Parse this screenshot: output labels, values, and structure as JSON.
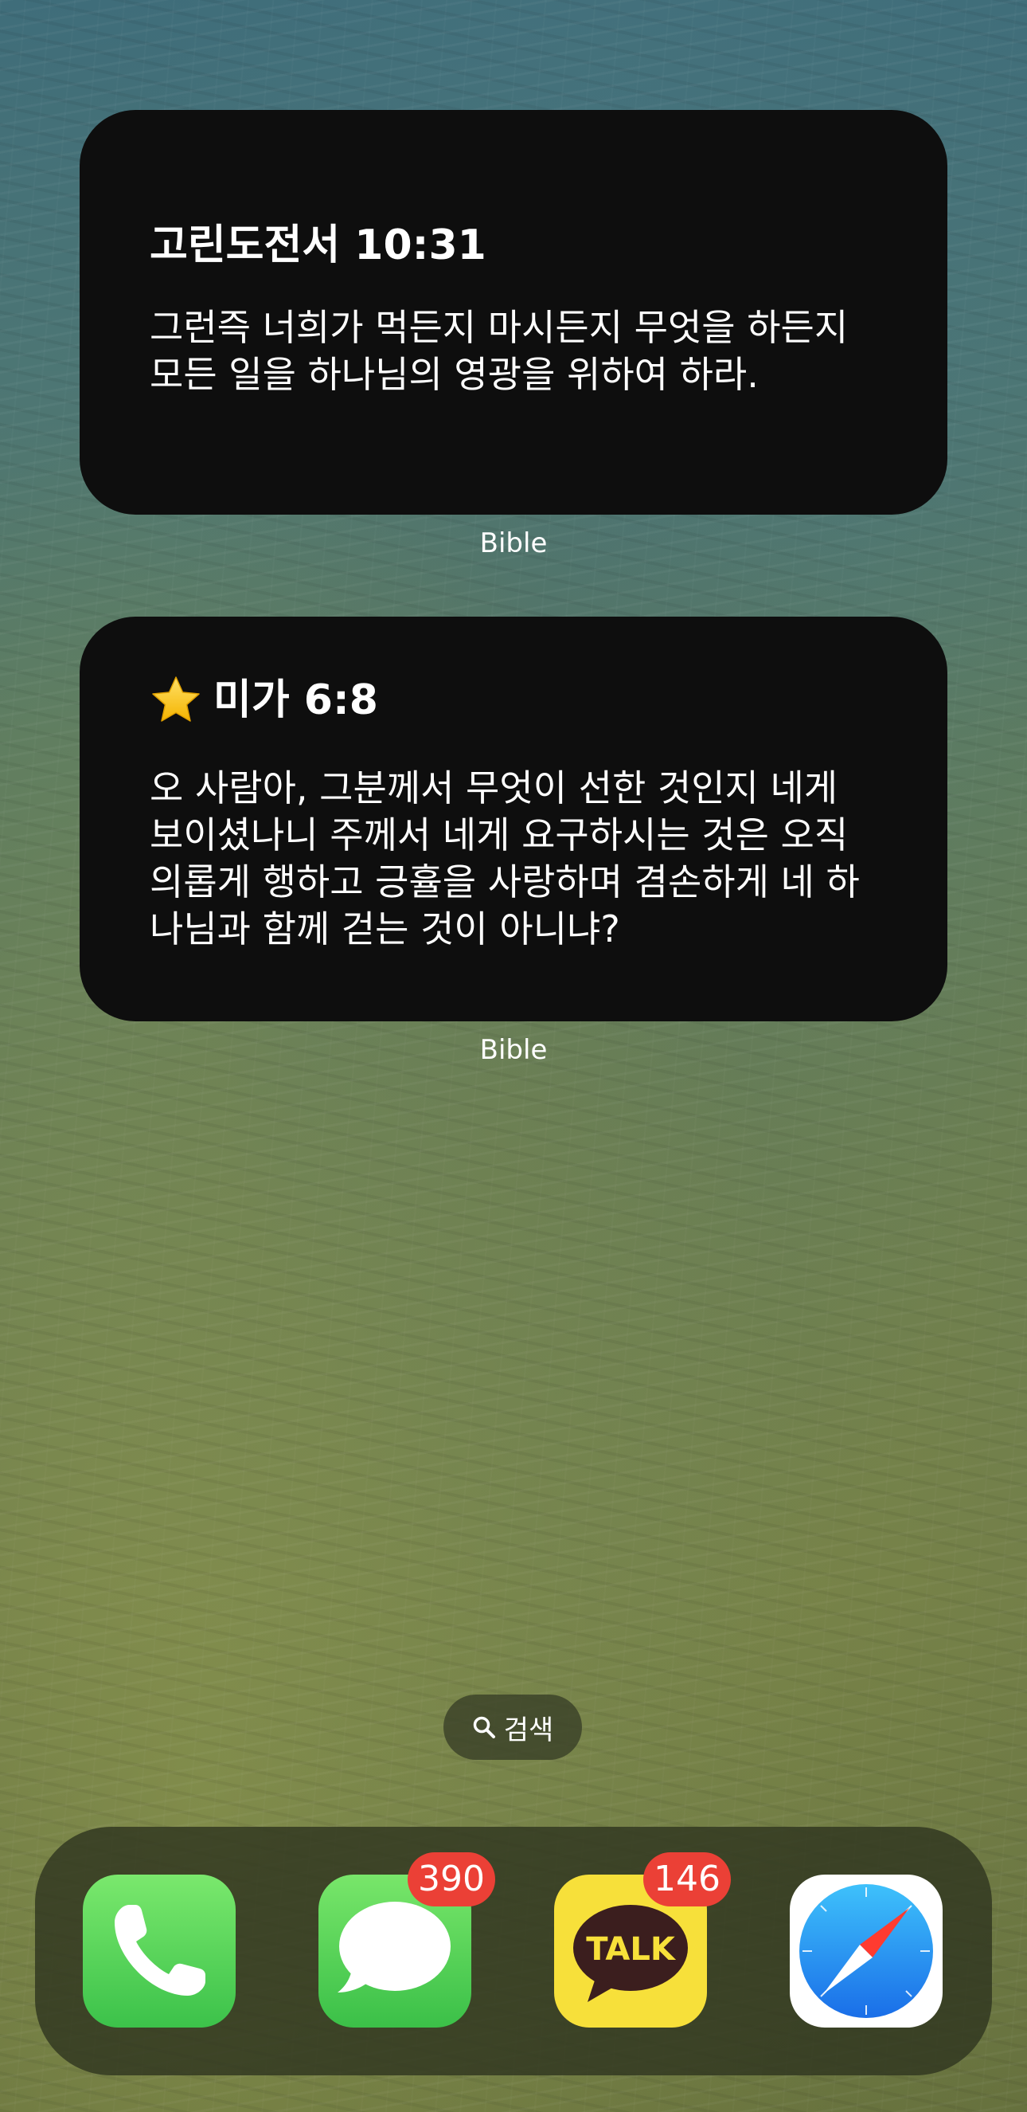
{
  "widgets": [
    {
      "title": "고린도전서 10:31",
      "body": "그런즉 너희가 먹든지 마시든지 무엇을 하든지 모든 일을 하나님의 영광을 위하여 하라.",
      "label": "Bible"
    },
    {
      "icon": "star-icon",
      "title": "미가 6:8",
      "body": "오 사람아, 그분께서 무엇이 선한 것인지 네게 보이셨나니 주께서 네게 요구하시는 것은 오직 의롭게 행하고 긍휼을 사랑하며 겸손하게 네 하나님과 함께 걷는 것이 아니냐?",
      "label": "Bible"
    }
  ],
  "search": {
    "label": "검색",
    "icon": "search-icon"
  },
  "dock": {
    "apps": [
      {
        "name": "Phone",
        "icon": "phone-icon",
        "badge": null
      },
      {
        "name": "Messages",
        "icon": "speech-bubble-icon",
        "badge": "390"
      },
      {
        "name": "KakaoTalk",
        "icon": "talk-bubble-icon",
        "icon_text": "TALK",
        "badge": "146"
      },
      {
        "name": "Safari",
        "icon": "compass-icon",
        "badge": null
      }
    ]
  },
  "colors": {
    "widget_bg": "#0e0e0e",
    "badge_red": "#eb4036",
    "kakao_yellow": "#f7e03a",
    "ios_green": "#3cc24a"
  }
}
